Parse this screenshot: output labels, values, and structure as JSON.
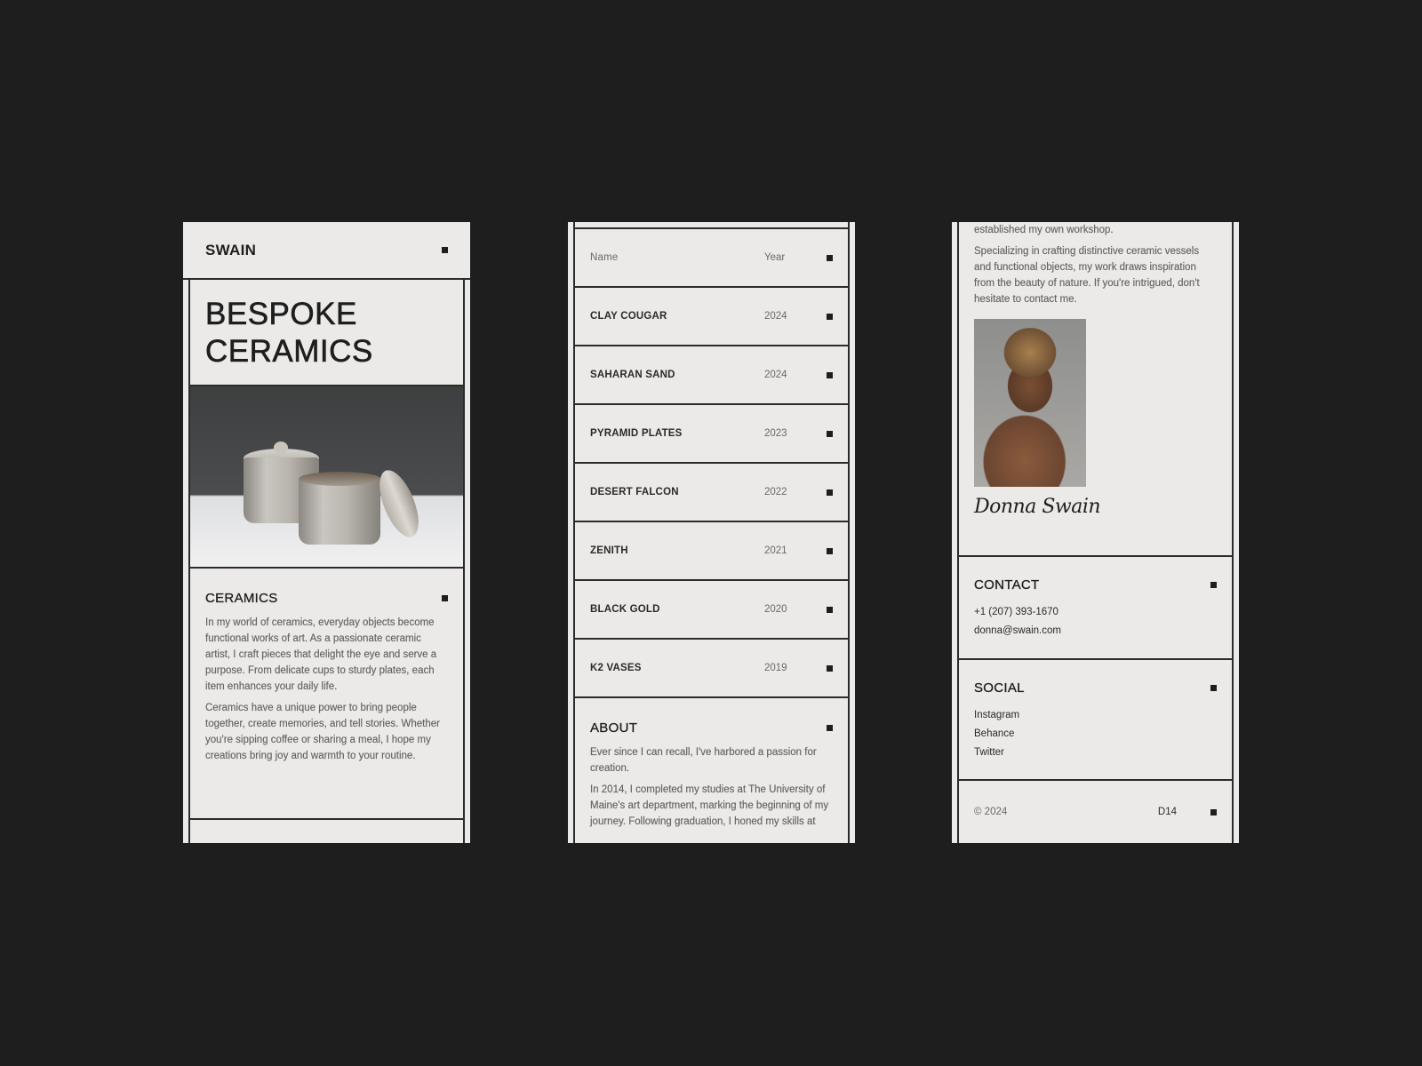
{
  "screen1": {
    "brand": "SWAIN",
    "hero_title_line1": "BESPOKE",
    "hero_title_line2": "CERAMICS",
    "image_alt": "Two lidded stoneware ceramic jars on a white table",
    "section": {
      "title": "CERAMICS",
      "paragraphs": [
        "In my world of ceramics, everyday objects become functional works of art. As a passionate ceramic artist, I craft pieces that delight the eye and serve a purpose. From delicate cups to sturdy plates, each item enhances your daily life.",
        "Ceramics have a unique power to bring people together, create memories, and tell stories. Whether you're sipping coffee or sharing a meal, I hope my creations bring joy and warmth to your routine."
      ]
    }
  },
  "screen2": {
    "table": {
      "headers": {
        "name": "Name",
        "year": "Year"
      },
      "rows": [
        {
          "name": "CLAY COUGAR",
          "year": "2024"
        },
        {
          "name": "SAHARAN SAND",
          "year": "2024"
        },
        {
          "name": "PYRAMID PLATES",
          "year": "2023"
        },
        {
          "name": "DESERT FALCON",
          "year": "2022"
        },
        {
          "name": "ZENITH",
          "year": "2021"
        },
        {
          "name": "BLACK GOLD",
          "year": "2020"
        },
        {
          "name": "K2 VASES",
          "year": "2019"
        }
      ]
    },
    "about": {
      "title": "ABOUT",
      "paragraphs": [
        "Ever since I can recall, I've harbored a passion for creation.",
        "In 2014, I completed my studies at The University of Maine's art department, marking the beginning of my journey. Following graduation, I honed my skills at"
      ]
    }
  },
  "screen3": {
    "about_continued": [
      "established my own workshop.",
      "Specializing in crafting distinctive ceramic vessels and functional objects, my work draws inspiration from the beauty of nature. If you're intrigued, don't hesitate to contact me."
    ],
    "portrait_alt": "Portrait of Donna Swain",
    "signature": "Donna Swain",
    "contact": {
      "title": "CONTACT",
      "phone": "+1 (207) 393-1670",
      "email": "donna@swain.com"
    },
    "social": {
      "title": "SOCIAL",
      "links": [
        "Instagram",
        "Behance",
        "Twitter"
      ]
    },
    "footer": {
      "copyright": "© 2024",
      "code": "D14"
    }
  },
  "icons": {
    "square_bullet": "square-icon"
  },
  "colors": {
    "background": "#1e1e1e",
    "panel": "#ebeae8",
    "text": "#1e1e1e",
    "muted": "#666461",
    "line": "#2b2b2b"
  }
}
